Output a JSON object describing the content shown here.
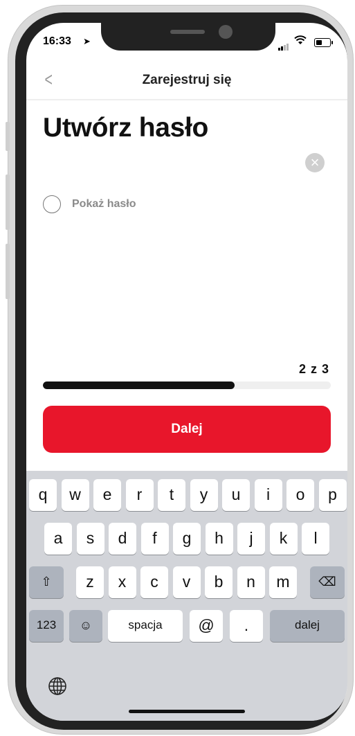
{
  "status_bar": {
    "time": "16:33",
    "location_glyph": "➤"
  },
  "nav": {
    "back_glyph": "<",
    "title": "Zarejestruj się"
  },
  "page": {
    "title": "Utwórz hasło",
    "password_value": "",
    "clear_glyph": "×",
    "show_password_label": "Pokaż hasło"
  },
  "progress": {
    "label": "2 z 3",
    "current": 2,
    "total": 3,
    "fill_fraction": 0.667
  },
  "next_button": {
    "label": "Dalej"
  },
  "keyboard": {
    "row1": [
      "q",
      "w",
      "e",
      "r",
      "t",
      "y",
      "u",
      "i",
      "o",
      "p"
    ],
    "row2": [
      "a",
      "s",
      "d",
      "f",
      "g",
      "h",
      "j",
      "k",
      "l"
    ],
    "row3": [
      "z",
      "x",
      "c",
      "v",
      "b",
      "n",
      "m"
    ],
    "shift_glyph": "⇧",
    "delete_glyph": "⌫",
    "numbers_label": "123",
    "emoji_glyph": "☺",
    "space_label": "spacja",
    "at_label": "@",
    "dot_label": ".",
    "return_label": "dalej"
  },
  "colors": {
    "accent": "#e8162b",
    "progress_fill": "#111111",
    "keyboard_bg": "#d2d4d9"
  }
}
